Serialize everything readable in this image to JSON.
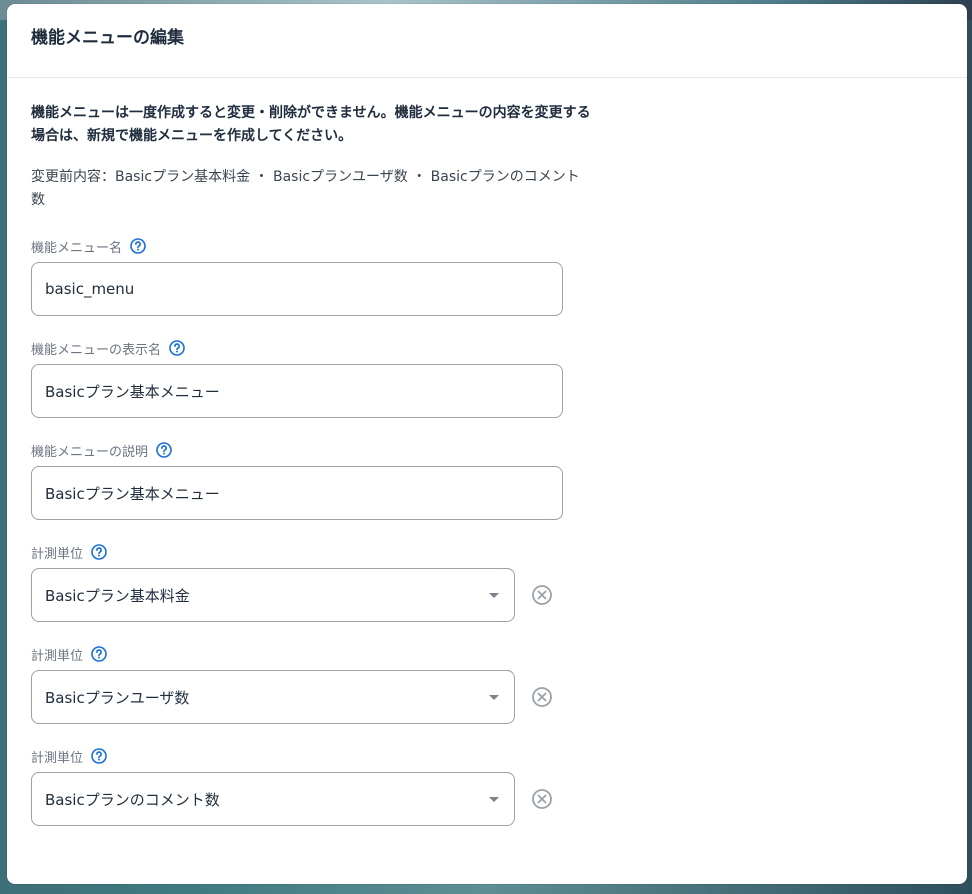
{
  "modal": {
    "title": "機能メニューの編集",
    "notice": "機能メニューは一度作成すると変更・削除ができません。機能メニューの内容を変更する場合は、新規で機能メニューを作成してください。",
    "previous": "変更前内容：Basicプラン基本料金 ・ Basicプランユーザ数 ・ Basicプランのコメント数"
  },
  "fields": {
    "name": {
      "label": "機能メニュー名",
      "value": "basic_menu"
    },
    "display_name": {
      "label": "機能メニューの表示名",
      "value": "Basicプラン基本メニュー"
    },
    "description": {
      "label": "機能メニューの説明",
      "value": "Basicプラン基本メニュー"
    }
  },
  "units": [
    {
      "label": "計測単位",
      "value": "Basicプラン基本料金"
    },
    {
      "label": "計測単位",
      "value": "Basicプランユーザ数"
    },
    {
      "label": "計測単位",
      "value": "Basicプランのコメント数"
    }
  ],
  "icons": {
    "help": "question-circle-icon",
    "remove": "x-circle-icon",
    "caret": "caret-down-icon"
  },
  "colors": {
    "help_icon": "#1a6fd8",
    "remove_icon": "#9aa1a9",
    "input_border": "#9aa1a9",
    "label_text": "#6b7480",
    "title_text": "#1f2d3d"
  }
}
